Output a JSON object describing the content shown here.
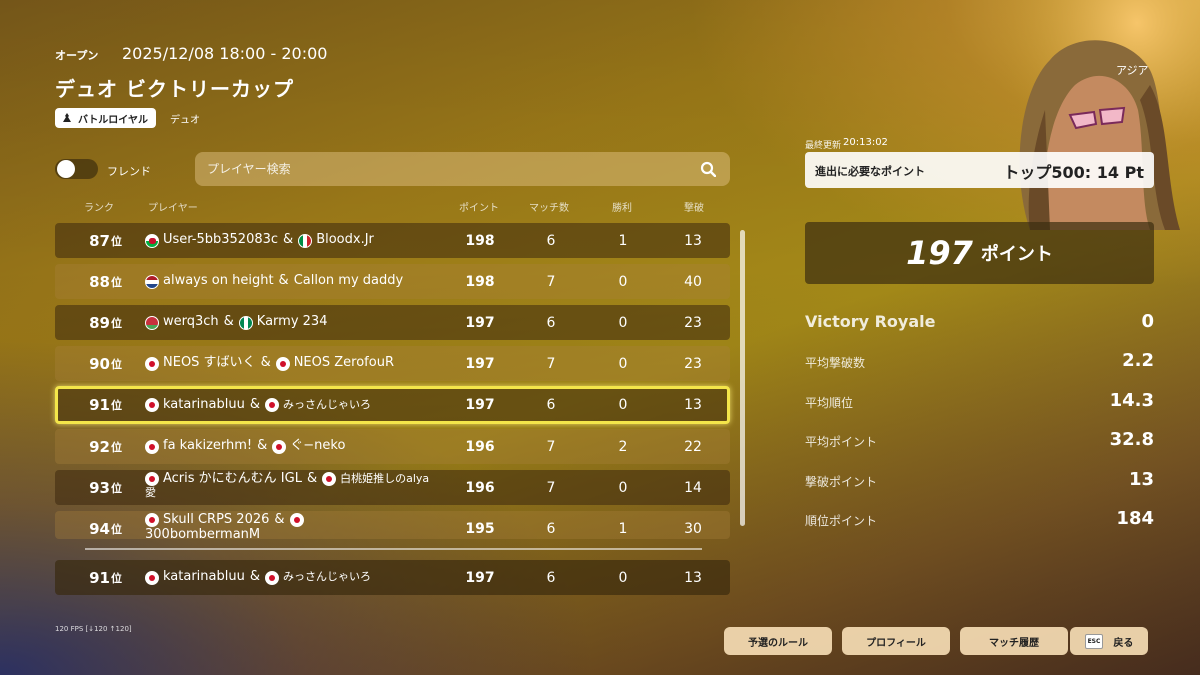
{
  "header": {
    "status": "オープン",
    "datetime": "2025/12/08 18:00 - 20:00",
    "title": "デュオ ビクトリーカップ",
    "mode_badge": "バトルロイヤル",
    "mode_sub": "デュオ"
  },
  "controls": {
    "friend_toggle_label": "フレンド",
    "friend_toggle_on": false,
    "search_placeholder": "プレイヤー検索"
  },
  "columns": {
    "rank": "ランク",
    "player": "プレイヤー",
    "points": "ポイント",
    "matches": "マッチ数",
    "wins": "勝利",
    "kills": "撃破"
  },
  "rows": [
    {
      "rank": "87",
      "suffix": "位",
      "p1": {
        "flag": "wales",
        "name": "User-5bb352083c"
      },
      "sep": "&",
      "p2": {
        "flag": "italy",
        "name": "Bloodx.Jr"
      },
      "points": "198",
      "matches": "6",
      "wins": "1",
      "kills": "13"
    },
    {
      "rank": "88",
      "suffix": "位",
      "p1": {
        "flag": "netherlands",
        "name": "always on height"
      },
      "sep": "&",
      "p2": {
        "flag": "",
        "name": "Callon my daddy"
      },
      "points": "198",
      "matches": "7",
      "wins": "0",
      "kills": "40"
    },
    {
      "rank": "89",
      "suffix": "位",
      "p1": {
        "flag": "belarus",
        "name": "werq3ch"
      },
      "sep": "&",
      "p2": {
        "flag": "nigeria",
        "name": "Karmy 234"
      },
      "points": "197",
      "matches": "6",
      "wins": "0",
      "kills": "23"
    },
    {
      "rank": "90",
      "suffix": "位",
      "p1": {
        "flag": "japan",
        "name": "NEOS すばいく"
      },
      "sep": "&",
      "p2": {
        "flag": "japan",
        "name": "NEOS ZerofouR"
      },
      "points": "197",
      "matches": "7",
      "wins": "0",
      "kills": "23"
    },
    {
      "rank": "91",
      "suffix": "位",
      "p1": {
        "flag": "japan",
        "name": "katarinabluu"
      },
      "sep": "&",
      "p2": {
        "flag": "japan",
        "name": "みっさんじゃいろ"
      },
      "points": "197",
      "matches": "6",
      "wins": "0",
      "kills": "13"
    },
    {
      "rank": "92",
      "suffix": "位",
      "p1": {
        "flag": "japan",
        "name": "fa kakizerhm!"
      },
      "sep": "&",
      "p2": {
        "flag": "japan",
        "name": "ぐ−neko"
      },
      "points": "196",
      "matches": "7",
      "wins": "2",
      "kills": "22"
    },
    {
      "rank": "93",
      "suffix": "位",
      "p1": {
        "flag": "japan",
        "name": "Acris かにむんむん IGL"
      },
      "sep": "&",
      "p2": {
        "flag": "japan",
        "name": "白桃姫推しのalya"
      },
      "line2": "愛",
      "points": "196",
      "matches": "7",
      "wins": "0",
      "kills": "14"
    },
    {
      "rank": "94",
      "suffix": "位",
      "p1": {
        "flag": "japan",
        "name": "Skull CRPS 2026"
      },
      "sep": "&",
      "p2": {
        "flag": "japan",
        "name": ""
      },
      "line2": "300bombermanM",
      "points": "195",
      "matches": "6",
      "wins": "1",
      "kills": "30"
    }
  ],
  "current_user_row": {
    "rank": "91",
    "suffix": "位",
    "p1": {
      "flag": "japan",
      "name": "katarinabluu"
    },
    "sep": "&",
    "p2": {
      "flag": "japan",
      "name": "みっさんじゃいろ"
    },
    "points": "197",
    "matches": "6",
    "wins": "0",
    "kills": "13"
  },
  "right_panel": {
    "region": "アジア",
    "updated_label": "最終更新",
    "updated_time": "20:13:02",
    "required_label": "進出に必要なポイント",
    "required_value": "トップ500: 14 Pt",
    "points_value": "197",
    "points_unit": "ポイント",
    "stats": [
      {
        "label": "Victory Royale",
        "value": "0"
      },
      {
        "label": "平均撃破数",
        "value": "2.2"
      },
      {
        "label": "平均順位",
        "value": "14.3"
      },
      {
        "label": "平均ポイント",
        "value": "32.8"
      },
      {
        "label": "撃破ポイント",
        "value": "13"
      },
      {
        "label": "順位ポイント",
        "value": "184"
      }
    ]
  },
  "footer": {
    "fps": "120 FPS [↓120 ↑120]",
    "buttons": {
      "rules": "予選のルール",
      "profile": "プロフィール",
      "history": "マッチ履歴",
      "esc_key": "ESC",
      "back": "戻る"
    }
  },
  "colors": {
    "highlight_border": "#f4e64a",
    "button_bg": "#f5dcb4"
  }
}
